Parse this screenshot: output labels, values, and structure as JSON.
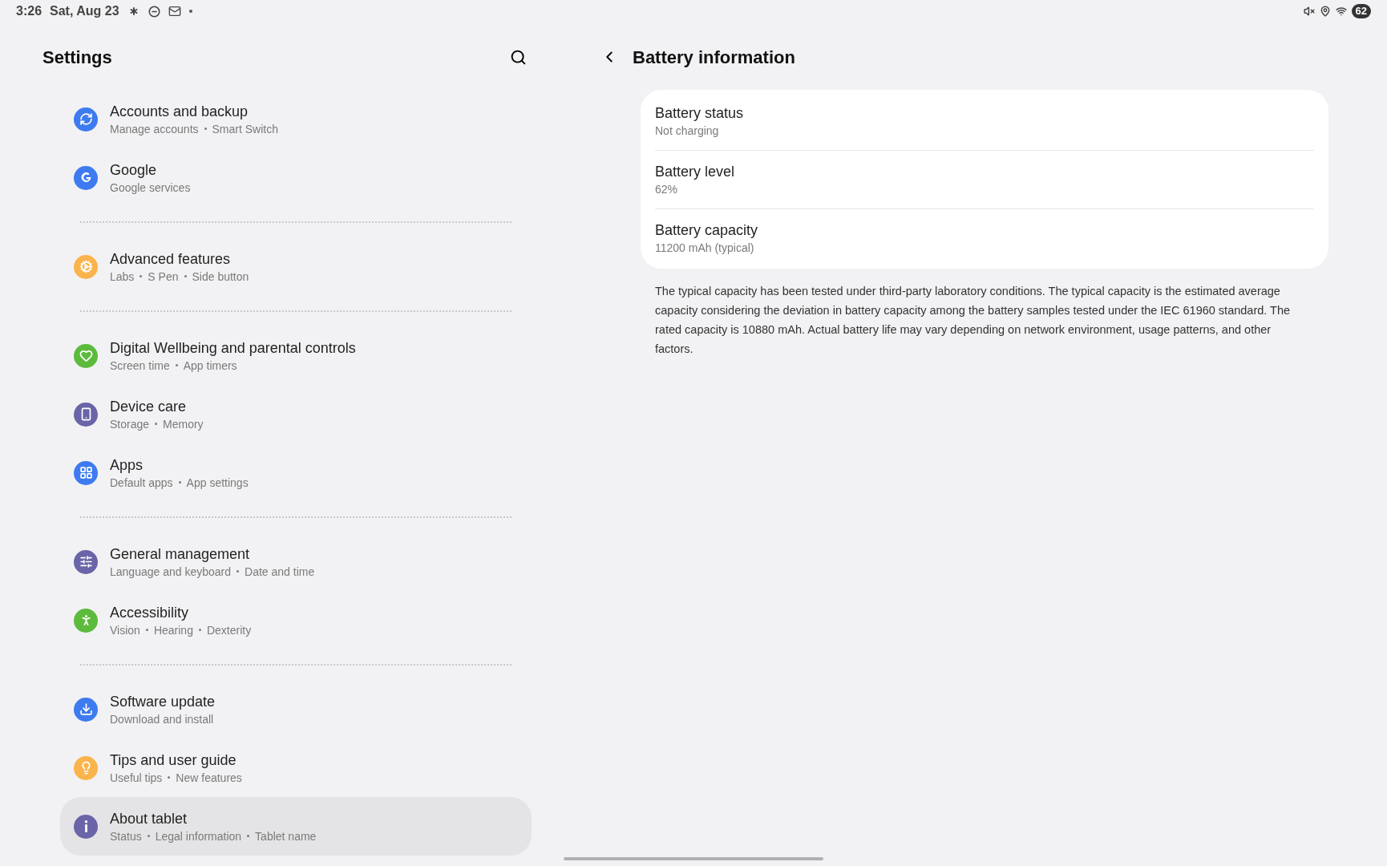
{
  "status_bar": {
    "time": "3:26",
    "date": "Sat, Aug 23",
    "battery": "62"
  },
  "settings": {
    "title": "Settings",
    "groups": [
      {
        "items": [
          {
            "color": "#3e7bf0",
            "title": "Accounts and backup",
            "subtitle": [
              "Manage accounts",
              "Smart Switch"
            ],
            "selected": false
          },
          {
            "color": "#3e7bf0",
            "title": "Google",
            "subtitle": [
              "Google services"
            ],
            "selected": false
          }
        ]
      },
      {
        "items": [
          {
            "color": "#fbb34c",
            "title": "Advanced features",
            "subtitle": [
              "Labs",
              "S Pen",
              "Side button"
            ],
            "selected": false
          }
        ]
      },
      {
        "items": [
          {
            "color": "#5cbb3c",
            "title": "Digital Wellbeing and parental controls",
            "subtitle": [
              "Screen time",
              "App timers"
            ],
            "selected": false
          },
          {
            "color": "#6a64a8",
            "title": "Device care",
            "subtitle": [
              "Storage",
              "Memory"
            ],
            "selected": false
          },
          {
            "color": "#3e7bf0",
            "title": "Apps",
            "subtitle": [
              "Default apps",
              "App settings"
            ],
            "selected": false
          }
        ]
      },
      {
        "items": [
          {
            "color": "#6a64a8",
            "title": "General management",
            "subtitle": [
              "Language and keyboard",
              "Date and time"
            ],
            "selected": false
          },
          {
            "color": "#5cbb3c",
            "title": "Accessibility",
            "subtitle": [
              "Vision",
              "Hearing",
              "Dexterity"
            ],
            "selected": false
          }
        ]
      },
      {
        "items": [
          {
            "color": "#3e7bf0",
            "title": "Software update",
            "subtitle": [
              "Download and install"
            ],
            "selected": false
          },
          {
            "color": "#fbb34c",
            "title": "Tips and user guide",
            "subtitle": [
              "Useful tips",
              "New features"
            ],
            "selected": false
          },
          {
            "color": "#6a64a8",
            "title": "About tablet",
            "subtitle": [
              "Status",
              "Legal information",
              "Tablet name"
            ],
            "selected": true
          }
        ]
      }
    ]
  },
  "detail": {
    "title": "Battery information",
    "rows": [
      {
        "title": "Battery status",
        "value": "Not charging"
      },
      {
        "title": "Battery level",
        "value": "62%"
      },
      {
        "title": "Battery capacity",
        "value": "11200 mAh (typical)"
      }
    ],
    "note": "The typical capacity has been tested under third-party laboratory conditions. The typical capacity is the estimated average capacity considering the deviation in battery capacity among the battery samples tested under the IEC 61960 standard. The rated capacity is 10880 mAh. Actual battery life may vary depending on network environment, usage patterns, and other factors."
  }
}
